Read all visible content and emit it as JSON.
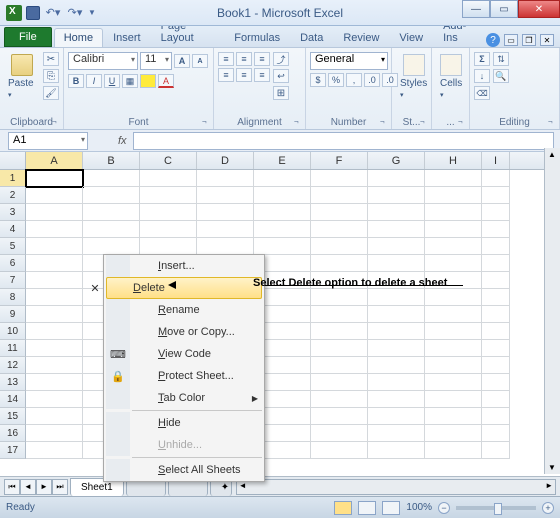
{
  "title": "Book1 - Microsoft Excel",
  "tabs": {
    "file": "File",
    "list": [
      "Home",
      "Insert",
      "Page Layout",
      "Formulas",
      "Data",
      "Review",
      "View",
      "Add-Ins"
    ],
    "active": 0
  },
  "ribbon": {
    "clipboard": {
      "label": "Clipboard",
      "paste": "Paste"
    },
    "font": {
      "label": "Font",
      "name": "Calibri",
      "size": "11"
    },
    "align": {
      "label": "Alignment"
    },
    "number": {
      "label": "Number",
      "format": "General"
    },
    "styles": {
      "label": "St...",
      "btn": "Styles"
    },
    "cells": {
      "label": "...",
      "btn": "Cells"
    },
    "editing": {
      "label": "Editing"
    }
  },
  "namebox": "A1",
  "fx": "fx",
  "cols": [
    "A",
    "B",
    "C",
    "D",
    "E",
    "F",
    "G",
    "H",
    "I"
  ],
  "rows": [
    1,
    2,
    3,
    4,
    5,
    6,
    7,
    8,
    9,
    10,
    11,
    12,
    13,
    14,
    15,
    16,
    17
  ],
  "ctx": {
    "insert": "Insert...",
    "delete": "Delete",
    "rename": "Rename",
    "move": "Move or Copy...",
    "view": "View Code",
    "protect": "Protect Sheet...",
    "tabcolor": "Tab Color",
    "hide": "Hide",
    "unhide": "Unhide...",
    "selectall": "Select All Sheets"
  },
  "annotation": "Select Delete option to delete a sheet",
  "sheet": "Sheet1",
  "status": {
    "ready": "Ready",
    "zoom": "100%"
  }
}
